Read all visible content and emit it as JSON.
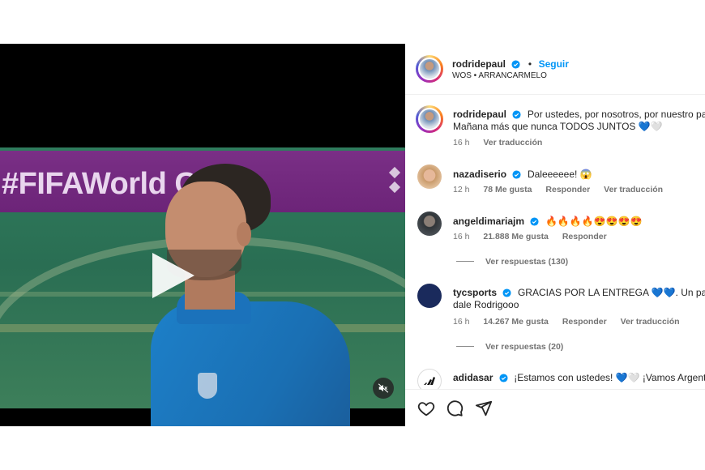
{
  "video": {
    "banner_text": "#FIFAWorld Cup",
    "state": "paused",
    "muted": true
  },
  "header": {
    "username": "rodridepaul",
    "dot": "•",
    "follow_label": "Seguir",
    "audio": "WOS • ARRANCARMELO"
  },
  "caption": {
    "username": "rodridepaul",
    "text_line1": "Por ustedes, por nosotros, por nuestro pa",
    "text_line2": "Mañana más que nunca TODOS JUNTOS 💙🤍",
    "time": "16 h",
    "translate": "Ver traducción"
  },
  "comments": [
    {
      "username": "nazadiserio",
      "text": "Daleeeeee! 😱",
      "time": "12 h",
      "likes": "78 Me gusta",
      "reply": "Responder",
      "translate": "Ver traducción"
    },
    {
      "username": "angeldimariajm",
      "text": "🔥🔥🔥🔥😍😍😍😍",
      "time": "16 h",
      "likes": "21.888 Me gusta",
      "reply": "Responder",
      "view_replies": "Ver respuestas (130)"
    },
    {
      "username": "tycsports",
      "text_line1": "GRACIAS POR LA ENTREGA 💙💙. Un paso",
      "text_line2": "dale Rodrigooo",
      "time": "16 h",
      "likes": "14.267 Me gusta",
      "reply": "Responder",
      "translate": "Ver traducción",
      "view_replies": "Ver respuestas (20)"
    },
    {
      "username": "adidasar",
      "text": "¡Estamos con ustedes! 💙🤍 ¡Vamos Argentin"
    }
  ],
  "icons": {
    "like": "heart-icon",
    "comment": "comment-icon",
    "share": "share-icon",
    "mute": "muted-speaker-icon",
    "play": "play-icon",
    "verified": "verified-badge-icon"
  },
  "colors": {
    "link_blue": "#0095f6",
    "verified_blue": "#0095f6",
    "muted_text": "#737373"
  }
}
